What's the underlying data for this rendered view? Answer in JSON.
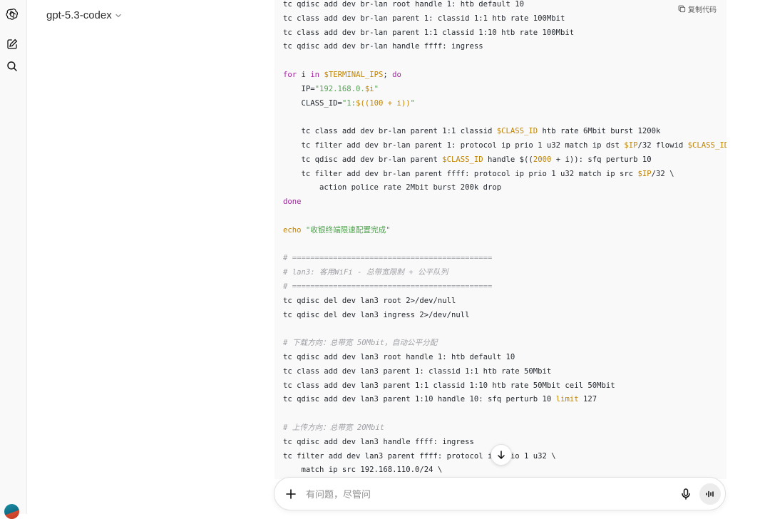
{
  "header": {
    "model_name": "gpt-5.3-codex"
  },
  "code_block": {
    "copy_label": "复制代码",
    "lines": [
      [
        [
          "",
          "tc qdisc add dev br-lan root handle 1: htb default 10"
        ]
      ],
      [
        [
          "",
          "tc class add dev br-lan parent 1: classid 1:1 htb rate 100Mbit"
        ]
      ],
      [
        [
          "",
          "tc class add dev br-lan parent 1:1 classid 1:10 htb rate 100Mbit"
        ]
      ],
      [
        [
          "",
          "tc qdisc add dev br-lan handle ffff: ingress"
        ]
      ],
      [],
      [
        [
          "kw",
          "for"
        ],
        [
          "",
          " i "
        ],
        [
          "kw",
          "in"
        ],
        [
          "",
          " "
        ],
        [
          "var",
          "$TERMINAL_IPS"
        ],
        [
          "",
          "; "
        ],
        [
          "kw",
          "do"
        ]
      ],
      [
        [
          "",
          "    IP="
        ],
        [
          "str",
          "\"192.168.0."
        ],
        [
          "var",
          "$i"
        ],
        [
          "str",
          "\""
        ]
      ],
      [
        [
          "",
          "    CLASS_ID="
        ],
        [
          "str",
          "\"1:"
        ],
        [
          "var",
          "$((100 + i))"
        ],
        [
          "str",
          "\""
        ]
      ],
      [],
      [
        [
          "",
          "    tc class add dev br-lan parent 1:1 classid "
        ],
        [
          "var",
          "$CLASS_ID"
        ],
        [
          "",
          " htb rate 6Mbit burst 1200k"
        ]
      ],
      [
        [
          "",
          "    tc filter add dev br-lan parent 1: protocol ip prio 1 u32 match ip dst "
        ],
        [
          "var",
          "$IP"
        ],
        [
          "",
          "/32 flowid "
        ],
        [
          "var",
          "$CLASS_ID"
        ]
      ],
      [
        [
          "",
          "    tc qdisc add dev br-lan parent "
        ],
        [
          "var",
          "$CLASS_ID"
        ],
        [
          "",
          " handle $(("
        ],
        [
          "num",
          "2000"
        ],
        [
          "",
          " + i)): sfq perturb 10"
        ]
      ],
      [
        [
          "",
          "    tc filter add dev br-lan parent ffff: protocol ip prio 1 u32 match ip src "
        ],
        [
          "var",
          "$IP"
        ],
        [
          "",
          "/32 \\"
        ]
      ],
      [
        [
          "",
          "        action police rate 2Mbit burst 200k drop"
        ]
      ],
      [
        [
          "kw",
          "done"
        ]
      ],
      [],
      [
        [
          "var",
          "echo"
        ],
        [
          "",
          " "
        ],
        [
          "str",
          "\"收银终端限速配置完成\""
        ]
      ],
      [],
      [
        [
          "cmt",
          "# ============================================"
        ]
      ],
      [
        [
          "cmt",
          "# lan3: 客用WiFi - 总带宽限制 + 公平队列"
        ]
      ],
      [
        [
          "cmt",
          "# ============================================"
        ]
      ],
      [
        [
          "",
          "tc qdisc del dev lan3 root 2>/dev/null"
        ]
      ],
      [
        [
          "",
          "tc qdisc del dev lan3 ingress 2>/dev/null"
        ]
      ],
      [],
      [
        [
          "cmt",
          "# 下载方向：总带宽 50Mbit，自动公平分配"
        ]
      ],
      [
        [
          "",
          "tc qdisc add dev lan3 root handle 1: htb default 10"
        ]
      ],
      [
        [
          "",
          "tc class add dev lan3 parent 1: classid 1:1 htb rate 50Mbit"
        ]
      ],
      [
        [
          "",
          "tc class add dev lan3 parent 1:1 classid 1:10 htb rate 50Mbit ceil 50Mbit"
        ]
      ],
      [
        [
          "",
          "tc qdisc add dev lan3 parent 1:10 handle 10: sfq perturb 10 "
        ],
        [
          "var",
          "limit"
        ],
        [
          "",
          " 127"
        ]
      ],
      [],
      [
        [
          "cmt",
          "# 上传方向：总带宽 20Mbit"
        ]
      ],
      [
        [
          "",
          "tc qdisc add dev lan3 handle ffff: ingress"
        ]
      ],
      [
        [
          "",
          "tc filter add dev lan3 parent ffff: protocol ip prio 1 u32 \\"
        ]
      ],
      [
        [
          "",
          "    match ip src 192.168.110.0/24 \\"
        ]
      ]
    ]
  },
  "composer": {
    "placeholder": "有问题，尽管问"
  },
  "colors": {
    "keyword": "#a626a4",
    "variable": "#c18401",
    "string": "#50a14f",
    "comment": "#a0a1a7"
  }
}
